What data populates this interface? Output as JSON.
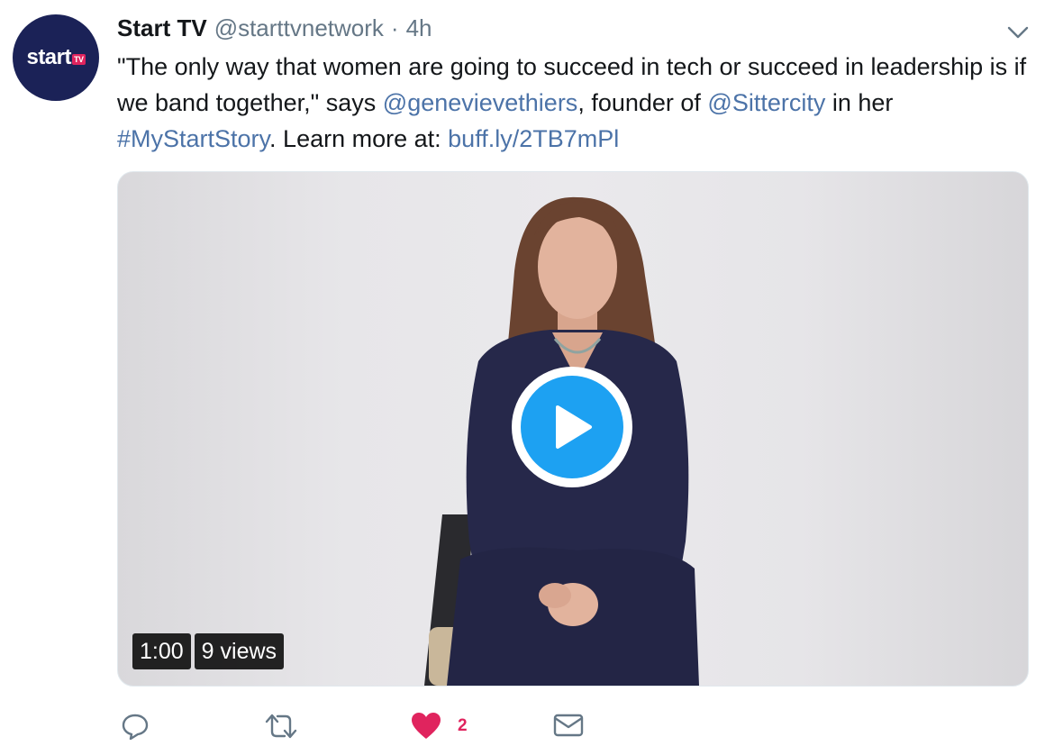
{
  "tweet": {
    "author_name": "Start TV",
    "author_handle": "@starttvnetwork",
    "separator": "·",
    "time": "4h",
    "avatar_logo_text": "start",
    "avatar_logo_badge": "TV",
    "text": {
      "part1": "\"The only way that women are going to succeed in tech or succeed in leadership is if we band together,\" says ",
      "mention1": "@genevievethiers",
      "part2": ", founder of ",
      "mention2": "@Sittercity",
      "part3": " in her ",
      "hashtag": "#MyStartStory",
      "part4": ". Learn more at: ",
      "link": "buff.ly/2TB7mPl"
    }
  },
  "video": {
    "duration": "1:00",
    "views": "9 views"
  },
  "actions": {
    "reply_icon": "reply-icon",
    "retweet_icon": "retweet-icon",
    "like_icon": "heart-icon",
    "like_count": "2",
    "dm_icon": "envelope-icon"
  },
  "colors": {
    "link": "#4c73a8",
    "like": "#e0245e",
    "play": "#1da1f2",
    "avatar_bg": "#1b2257"
  }
}
